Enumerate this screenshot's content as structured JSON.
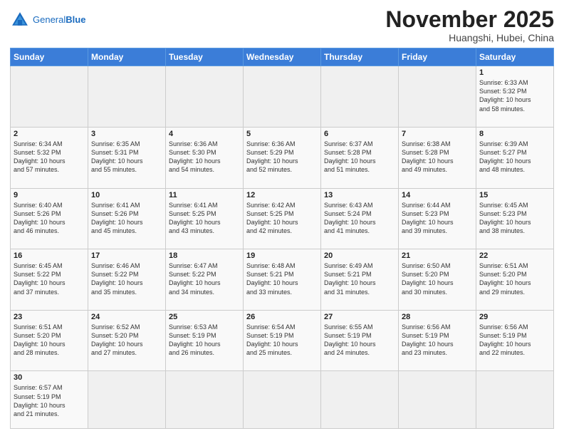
{
  "header": {
    "logo_general": "General",
    "logo_blue": "Blue",
    "month": "November 2025",
    "location": "Huangshi, Hubei, China"
  },
  "weekdays": [
    "Sunday",
    "Monday",
    "Tuesday",
    "Wednesday",
    "Thursday",
    "Friday",
    "Saturday"
  ],
  "weeks": [
    [
      {
        "day": "",
        "info": ""
      },
      {
        "day": "",
        "info": ""
      },
      {
        "day": "",
        "info": ""
      },
      {
        "day": "",
        "info": ""
      },
      {
        "day": "",
        "info": ""
      },
      {
        "day": "",
        "info": ""
      },
      {
        "day": "1",
        "info": "Sunrise: 6:33 AM\nSunset: 5:32 PM\nDaylight: 10 hours\nand 58 minutes."
      }
    ],
    [
      {
        "day": "2",
        "info": "Sunrise: 6:34 AM\nSunset: 5:32 PM\nDaylight: 10 hours\nand 57 minutes."
      },
      {
        "day": "3",
        "info": "Sunrise: 6:35 AM\nSunset: 5:31 PM\nDaylight: 10 hours\nand 55 minutes."
      },
      {
        "day": "4",
        "info": "Sunrise: 6:36 AM\nSunset: 5:30 PM\nDaylight: 10 hours\nand 54 minutes."
      },
      {
        "day": "5",
        "info": "Sunrise: 6:36 AM\nSunset: 5:29 PM\nDaylight: 10 hours\nand 52 minutes."
      },
      {
        "day": "6",
        "info": "Sunrise: 6:37 AM\nSunset: 5:28 PM\nDaylight: 10 hours\nand 51 minutes."
      },
      {
        "day": "7",
        "info": "Sunrise: 6:38 AM\nSunset: 5:28 PM\nDaylight: 10 hours\nand 49 minutes."
      },
      {
        "day": "8",
        "info": "Sunrise: 6:39 AM\nSunset: 5:27 PM\nDaylight: 10 hours\nand 48 minutes."
      }
    ],
    [
      {
        "day": "9",
        "info": "Sunrise: 6:40 AM\nSunset: 5:26 PM\nDaylight: 10 hours\nand 46 minutes."
      },
      {
        "day": "10",
        "info": "Sunrise: 6:41 AM\nSunset: 5:26 PM\nDaylight: 10 hours\nand 45 minutes."
      },
      {
        "day": "11",
        "info": "Sunrise: 6:41 AM\nSunset: 5:25 PM\nDaylight: 10 hours\nand 43 minutes."
      },
      {
        "day": "12",
        "info": "Sunrise: 6:42 AM\nSunset: 5:25 PM\nDaylight: 10 hours\nand 42 minutes."
      },
      {
        "day": "13",
        "info": "Sunrise: 6:43 AM\nSunset: 5:24 PM\nDaylight: 10 hours\nand 41 minutes."
      },
      {
        "day": "14",
        "info": "Sunrise: 6:44 AM\nSunset: 5:23 PM\nDaylight: 10 hours\nand 39 minutes."
      },
      {
        "day": "15",
        "info": "Sunrise: 6:45 AM\nSunset: 5:23 PM\nDaylight: 10 hours\nand 38 minutes."
      }
    ],
    [
      {
        "day": "16",
        "info": "Sunrise: 6:45 AM\nSunset: 5:22 PM\nDaylight: 10 hours\nand 37 minutes."
      },
      {
        "day": "17",
        "info": "Sunrise: 6:46 AM\nSunset: 5:22 PM\nDaylight: 10 hours\nand 35 minutes."
      },
      {
        "day": "18",
        "info": "Sunrise: 6:47 AM\nSunset: 5:22 PM\nDaylight: 10 hours\nand 34 minutes."
      },
      {
        "day": "19",
        "info": "Sunrise: 6:48 AM\nSunset: 5:21 PM\nDaylight: 10 hours\nand 33 minutes."
      },
      {
        "day": "20",
        "info": "Sunrise: 6:49 AM\nSunset: 5:21 PM\nDaylight: 10 hours\nand 31 minutes."
      },
      {
        "day": "21",
        "info": "Sunrise: 6:50 AM\nSunset: 5:20 PM\nDaylight: 10 hours\nand 30 minutes."
      },
      {
        "day": "22",
        "info": "Sunrise: 6:51 AM\nSunset: 5:20 PM\nDaylight: 10 hours\nand 29 minutes."
      }
    ],
    [
      {
        "day": "23",
        "info": "Sunrise: 6:51 AM\nSunset: 5:20 PM\nDaylight: 10 hours\nand 28 minutes."
      },
      {
        "day": "24",
        "info": "Sunrise: 6:52 AM\nSunset: 5:20 PM\nDaylight: 10 hours\nand 27 minutes."
      },
      {
        "day": "25",
        "info": "Sunrise: 6:53 AM\nSunset: 5:19 PM\nDaylight: 10 hours\nand 26 minutes."
      },
      {
        "day": "26",
        "info": "Sunrise: 6:54 AM\nSunset: 5:19 PM\nDaylight: 10 hours\nand 25 minutes."
      },
      {
        "day": "27",
        "info": "Sunrise: 6:55 AM\nSunset: 5:19 PM\nDaylight: 10 hours\nand 24 minutes."
      },
      {
        "day": "28",
        "info": "Sunrise: 6:56 AM\nSunset: 5:19 PM\nDaylight: 10 hours\nand 23 minutes."
      },
      {
        "day": "29",
        "info": "Sunrise: 6:56 AM\nSunset: 5:19 PM\nDaylight: 10 hours\nand 22 minutes."
      }
    ],
    [
      {
        "day": "30",
        "info": "Sunrise: 6:57 AM\nSunset: 5:19 PM\nDaylight: 10 hours\nand 21 minutes.",
        "last": true
      },
      {
        "day": "",
        "info": "",
        "last": true
      },
      {
        "day": "",
        "info": "",
        "last": true
      },
      {
        "day": "",
        "info": "",
        "last": true
      },
      {
        "day": "",
        "info": "",
        "last": true
      },
      {
        "day": "",
        "info": "",
        "last": true
      },
      {
        "day": "",
        "info": "",
        "last": true
      }
    ]
  ]
}
